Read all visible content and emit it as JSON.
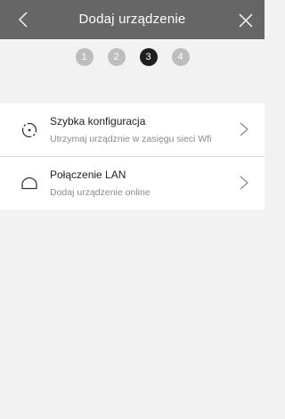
{
  "header": {
    "title": "Dodaj urządzenie",
    "back_icon": "chevron-left-icon",
    "close_icon": "close-icon",
    "background": "#666666"
  },
  "steps": {
    "items": [
      "1",
      "2",
      "3",
      "4"
    ],
    "active": "3",
    "active_color": "#1f1f1f",
    "inactive_color": "#bdbdbd"
  },
  "options": [
    {
      "icon": "quick-config-icon",
      "label": "Szybka konfiguracja",
      "sub": "Utrzymaj urządznie w zasięgu sieci Wfi"
    },
    {
      "icon": "cloud-icon",
      "label": "Połączenie LAN",
      "sub": "Dodaj urządzenie online"
    }
  ]
}
